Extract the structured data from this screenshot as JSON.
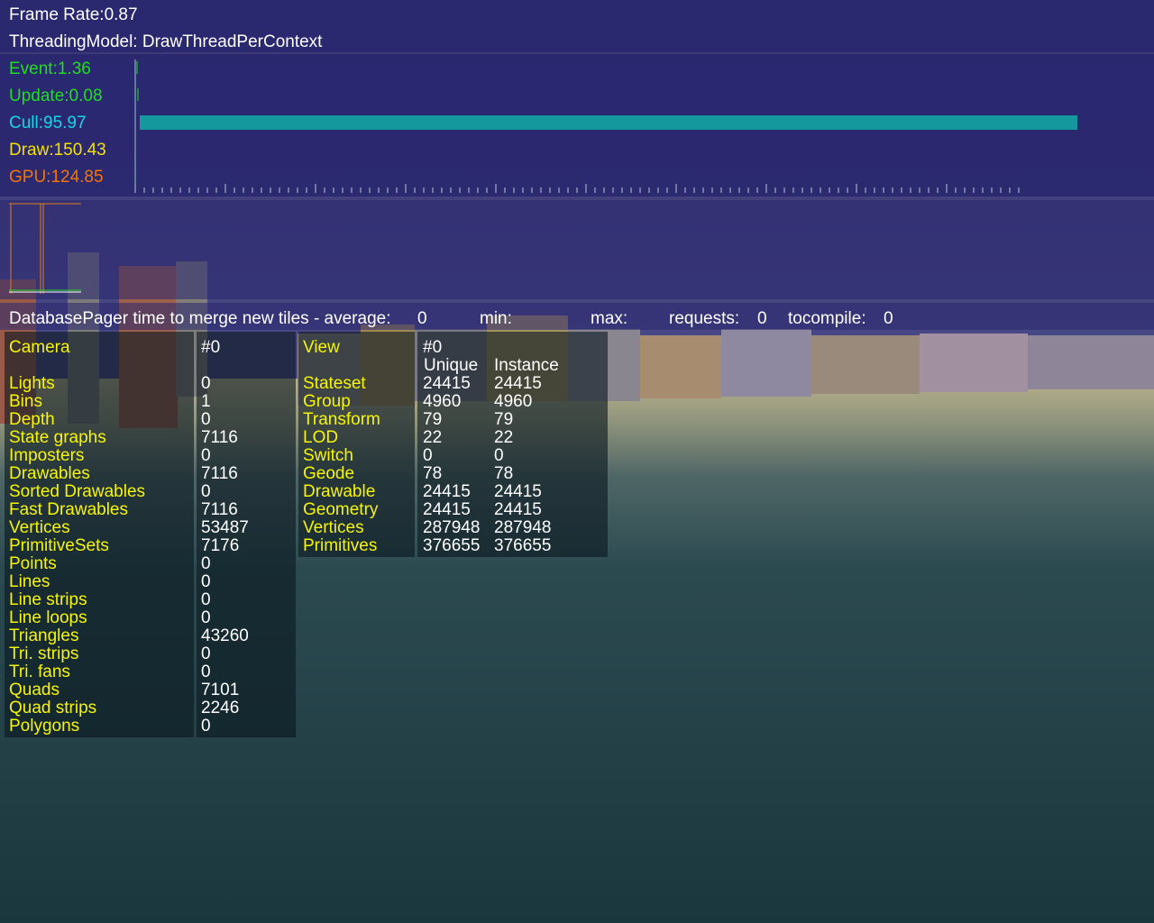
{
  "header": {
    "frame_rate": "Frame Rate:0.87",
    "threading_model": "ThreadingModel: DrawThreadPerContext"
  },
  "timings": {
    "event": "Event:1.36",
    "update": "Update:0.08",
    "cull": "Cull:95.97",
    "draw": "Draw:150.43",
    "gpu": "GPU:124.85",
    "cull_bar_fraction": 1.0
  },
  "colors": {
    "event": "#22dd22",
    "update": "#22dd22",
    "cull": "#16d6e6",
    "draw": "#f3e000",
    "gpu": "#f0760a",
    "cull_bar": "#15979e",
    "hud_bg": "#2c2a72",
    "stats_text": "#f6f600"
  },
  "pager": {
    "label": "DatabasePager time to merge new tiles - average:",
    "average": "0",
    "min_label": "min:",
    "max_label": "max:",
    "requests_label": "requests:",
    "requests": "0",
    "tocompile_label": "tocompile:",
    "tocompile": "0"
  },
  "camera_stats": {
    "title": "Camera",
    "id": "#0",
    "labels": [
      "Lights",
      "Bins",
      "Depth",
      "State graphs",
      "Imposters",
      "Drawables",
      "Sorted Drawables",
      "Fast Drawables",
      "Vertices",
      "PrimitiveSets",
      "Points",
      "Lines",
      "Line strips",
      "Line loops",
      "Triangles",
      "Tri. strips",
      "Tri. fans",
      "Quads",
      "Quad strips",
      "Polygons"
    ],
    "values": [
      "0",
      "1",
      "0",
      "7116",
      "0",
      "7116",
      "0",
      "7116",
      "53487",
      "7176",
      "0",
      "0",
      "0",
      "0",
      "43260",
      "0",
      "0",
      "7101",
      "2246",
      "0"
    ]
  },
  "view_stats": {
    "title": "View",
    "id": "#0",
    "unique_header": "Unique",
    "instance_header": "Instance",
    "labels": [
      "Stateset",
      "Group",
      "Transform",
      "LOD",
      "Switch",
      "Geode",
      "Drawable",
      "Geometry",
      "Vertices",
      "Primitives"
    ],
    "unique": [
      "24415",
      "4960",
      "79",
      "22",
      "0",
      "78",
      "24415",
      "24415",
      "287948",
      "376655"
    ],
    "instance": [
      "24415",
      "4960",
      "79",
      "22",
      "0",
      "78",
      "24415",
      "24415",
      "287948",
      "376655"
    ]
  }
}
